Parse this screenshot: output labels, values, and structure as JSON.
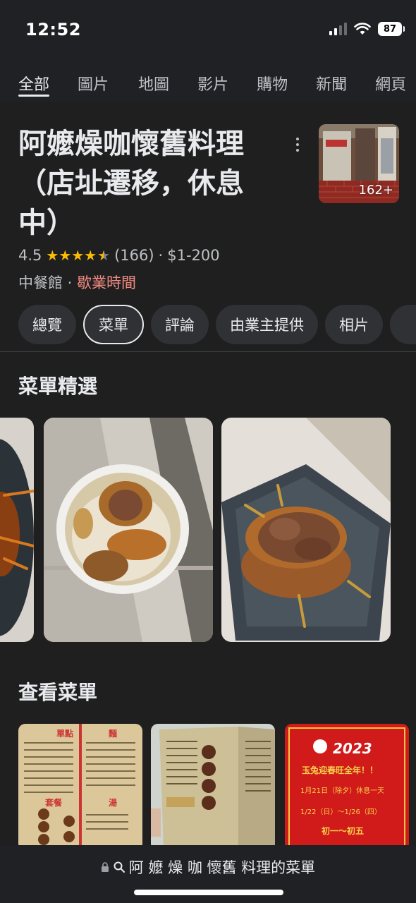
{
  "status": {
    "time": "12:52",
    "battery": "87"
  },
  "tabs": [
    "全部",
    "圖片",
    "地圖",
    "影片",
    "購物",
    "新聞",
    "網頁"
  ],
  "business": {
    "title": "阿嬤燥咖懷舊料理（店址遷移，休息中）",
    "photo_count": "162+",
    "rating": "4.5",
    "stars": "★★★★",
    "half_star": "★",
    "review_count": "(166)",
    "price": "$1-200",
    "category": "中餐館",
    "separator": " · ",
    "hours_link": "歇業時間"
  },
  "chips": [
    "總覽",
    "菜單",
    "評論",
    "由業主提供",
    "相片"
  ],
  "sections": {
    "featured": "菜單精選",
    "view_menu": "查看菜單"
  },
  "menu_images": {
    "m1": {
      "h1": "單點",
      "h2": "麵",
      "h3": "套餐",
      "h4": "湯"
    },
    "m3": {
      "year": "2023",
      "line1": "玉兔迎春旺全年！！",
      "line2": "1月21日（除夕）休息一天",
      "line3": "1/22（日）～1/26（四）",
      "line4": "初一～初五"
    }
  },
  "url_bar": {
    "text": "阿 嬤 燥 咖 懷舊 料理的菜單"
  },
  "colors": {
    "background": "#1f1f1f",
    "accent_link": "#f28b82",
    "star": "#fbbc04"
  }
}
